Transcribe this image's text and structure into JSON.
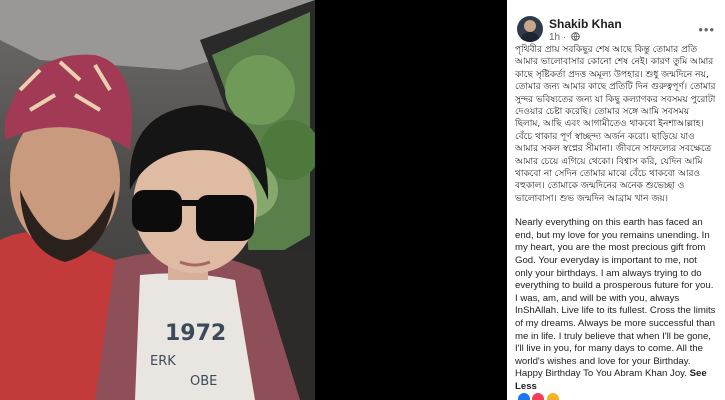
{
  "post": {
    "author": "Shakib Khan",
    "time": "1h",
    "separator": "·",
    "privacy_icon": "globe-icon",
    "more_icon": "more-horizontal-icon",
    "bengali_text": "পৃথিবীর প্রায় সবকিছুর শেষ আছে কিন্তু তোমার প্রতি আমার ভালোবাসার কোনো শেষ নেই। কারণ তুমি আমার কাছে সৃষ্টিকর্তা প্রদত্ত অমূল্য উপহার। শুধু জন্মদিনে নয়, তোমার জন্য আমার কাছে প্রতিটি দিন গুরুত্বপূর্ণ। তোমার সুন্দর ভবিষ্যতের জন্য যা কিছু কল্যাণকর সবসময় পুরোটা দেওয়ার চেষ্টা করেছি। তোমার সঙ্গে আমি সবসময় ছিলাম, আছি এবং আগামীতেও থাকবো ইনশাআল্লাহ। বেঁচে থাকার পূর্ণ স্বাচ্ছন্দ্য অর্জন করো। ছাড়িয়ে যাও আমার সকল স্বপ্নের সীমানা। জীবনে সাফল্যের সবক্ষেত্রে আমার চেয়ে এগিয়ে থেকো। বিশ্বাস করি, যেদিন আমি থাকবো না সেদিন তোমার মাঝে বেঁচে থাকবো আরও বহুকাল। তোমাকে জন্মদিনের অনেক শুভেচ্ছা ও ভালোবাসা। শুভ জন্মদিন আব্রাম খান জয়।",
    "english_text": "Nearly everything on this earth has faced an end, but my love for you remains unending. In my heart, you are the most precious gift from God. Your everyday is important to me, not only your birthdays. I am always trying to do everything to build a prosperous future for you. I was, am, and will be with you, always InShAllah. Live life to its fullest. Cross the limits of my dreams. Always be more successful than me in life. I truly believe that when I'll be gone, I'll live in you, for many days to come. All the world's wishes and love for your Birthday. Happy Birthday To You Abram Khan Joy.",
    "see_less_label": "See Less"
  },
  "photo": {
    "shirt_print": "1972",
    "shirt_print_2": "ERK",
    "shirt_print_3": "OBE"
  },
  "colors": {
    "name_text": "#1c1e21",
    "meta_text": "#65676b",
    "photo_backdrop": "#000000"
  }
}
